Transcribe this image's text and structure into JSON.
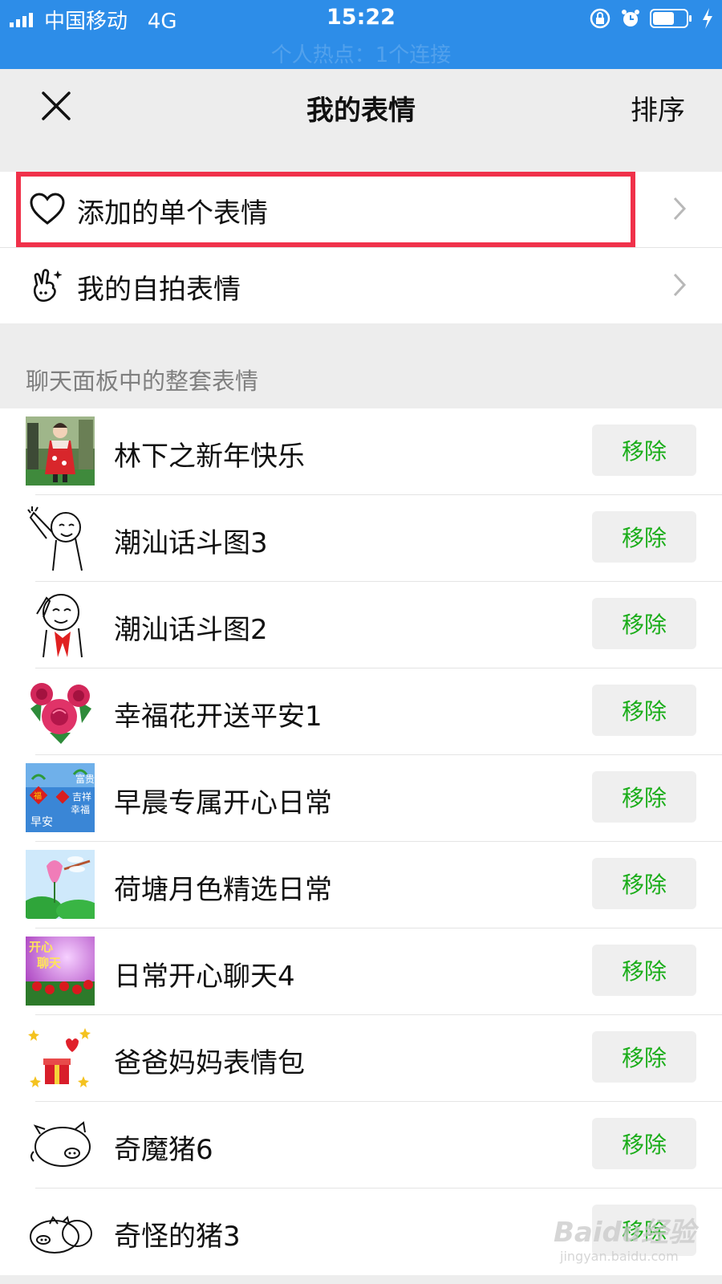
{
  "status_bar": {
    "carrier": "中国移动",
    "network": "4G",
    "time": "15:22",
    "ghost_text": "个人热点：1个连接"
  },
  "nav": {
    "title": "我的表情",
    "sort_label": "排序"
  },
  "entries": [
    {
      "label": "添加的单个表情",
      "icon": "heart-icon",
      "highlighted": true
    },
    {
      "label": "我的自拍表情",
      "icon": "selfie-hand-icon",
      "highlighted": false
    }
  ],
  "section_header": "聊天面板中的整套表情",
  "packs": [
    {
      "name": "林下之新年快乐",
      "remove_label": "移除",
      "thumb": "girl-red-dress"
    },
    {
      "name": "潮汕话斗图3",
      "remove_label": "移除",
      "thumb": "cartoon-waving"
    },
    {
      "name": "潮汕话斗图2",
      "remove_label": "移除",
      "thumb": "cartoon-salute"
    },
    {
      "name": "幸福花开送平安1",
      "remove_label": "移除",
      "thumb": "roses"
    },
    {
      "name": "早晨专属开心日常",
      "remove_label": "移除",
      "thumb": "morning-card",
      "thumb_text": {
        "a": "富贵",
        "b": "吉祥",
        "c": "幸福",
        "d": "早安",
        "e": "福"
      }
    },
    {
      "name": "荷塘月色精选日常",
      "remove_label": "移除",
      "thumb": "lotus-dragonfly"
    },
    {
      "name": "日常开心聊天4",
      "remove_label": "移除",
      "thumb": "kaixin-liaotian",
      "thumb_text": {
        "a": "开心",
        "b": "聊天"
      }
    },
    {
      "name": "爸爸妈妈表情包",
      "remove_label": "移除",
      "thumb": "gift-hearts"
    },
    {
      "name": "奇魔猪6",
      "remove_label": "移除",
      "thumb": "pig-outline"
    },
    {
      "name": "奇怪的猪3",
      "remove_label": "移除",
      "thumb": "pig-lying"
    }
  ],
  "watermark": {
    "main": "Baidu经验",
    "sub": "jingyan.baidu.com"
  },
  "colors": {
    "status_bar_bg": "#2d8de8",
    "highlight_border": "#f0314a",
    "remove_text": "#1aad19",
    "page_bg": "#ededed"
  }
}
